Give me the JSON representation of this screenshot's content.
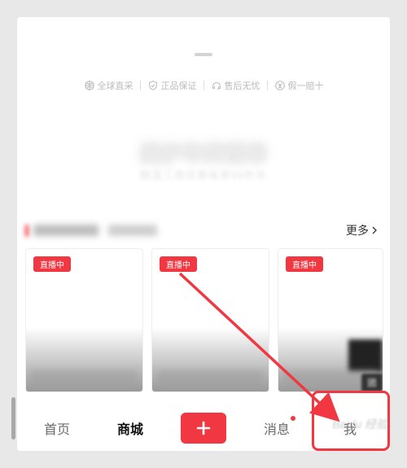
{
  "guarantees": [
    {
      "icon": "globe-icon",
      "label": "全球直采"
    },
    {
      "icon": "shield-icon",
      "label": "正品保证"
    },
    {
      "icon": "headset-icon",
      "label": "售后无忧"
    },
    {
      "icon": "yen-icon",
      "label": "假一赔十"
    }
  ],
  "hero": {
    "title": "美护年终榜单",
    "subtitle": "精选三周优惠每单99秒杀"
  },
  "section": {
    "more": "更多"
  },
  "live": {
    "pill": "直播中",
    "cornerBadge": "团"
  },
  "tabs": {
    "home": "首页",
    "mall": "商城",
    "msg": "消息",
    "me": "我"
  },
  "watermark": "Baidu 经验",
  "colors": {
    "accent": "#f03742"
  }
}
